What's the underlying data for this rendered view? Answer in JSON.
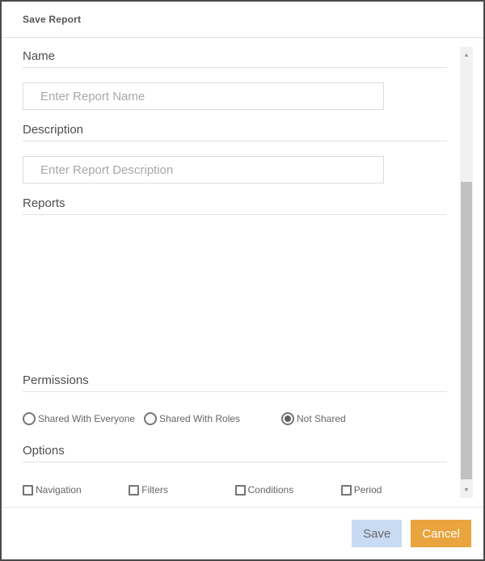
{
  "dialog": {
    "title": "Save Report"
  },
  "fields": {
    "name": {
      "label": "Name",
      "value": "",
      "placeholder": "Enter Report Name"
    },
    "description": {
      "label": "Description",
      "value": "",
      "placeholder": "Enter Report Description"
    }
  },
  "sections": {
    "reports_label": "Reports",
    "permissions_label": "Permissions",
    "options_label": "Options"
  },
  "permissions": {
    "options": [
      {
        "label": "Shared With Everyone",
        "selected": false
      },
      {
        "label": "Shared With Roles",
        "selected": false
      },
      {
        "label": "Not Shared",
        "selected": true
      }
    ]
  },
  "options": {
    "items": [
      {
        "label": "Navigation",
        "checked": false
      },
      {
        "label": "Filters",
        "checked": false
      },
      {
        "label": "Conditions",
        "checked": false
      },
      {
        "label": "Period",
        "checked": false
      }
    ]
  },
  "scrollbar": {
    "up_glyph": "▲",
    "down_glyph": "▼"
  },
  "footer": {
    "save_label": "Save",
    "cancel_label": "Cancel"
  },
  "colors": {
    "save_button_bg": "#c9dbf2",
    "cancel_button_bg": "#e9a43e",
    "border": "#4a4a4a"
  }
}
